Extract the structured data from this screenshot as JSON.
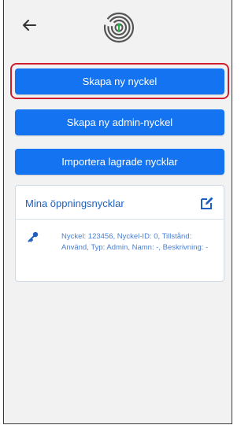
{
  "header": {
    "back_icon": "arrow-left-icon",
    "logo_icon": "fingerprint-logo-icon"
  },
  "buttons": {
    "create_key": "Skapa ny nyckel",
    "create_admin_key": "Skapa ny admin-nyckel",
    "import_keys": "Importera lagrade nycklar"
  },
  "keys_card": {
    "title": "Mina öppningsnycklar",
    "edit_icon": "edit-icon",
    "items": [
      {
        "icon": "key-icon",
        "details": "Nyckel: 123456, Nyckel-ID: 0, Tillstånd: Använd, Typ: Admin, Namn: -, Beskrivning: -"
      }
    ]
  },
  "colors": {
    "accent": "#1473f0",
    "highlight": "#d01e2e",
    "card_title": "#1f5fbf",
    "card_text": "#4a7fd0",
    "background": "#f2f2f2"
  }
}
